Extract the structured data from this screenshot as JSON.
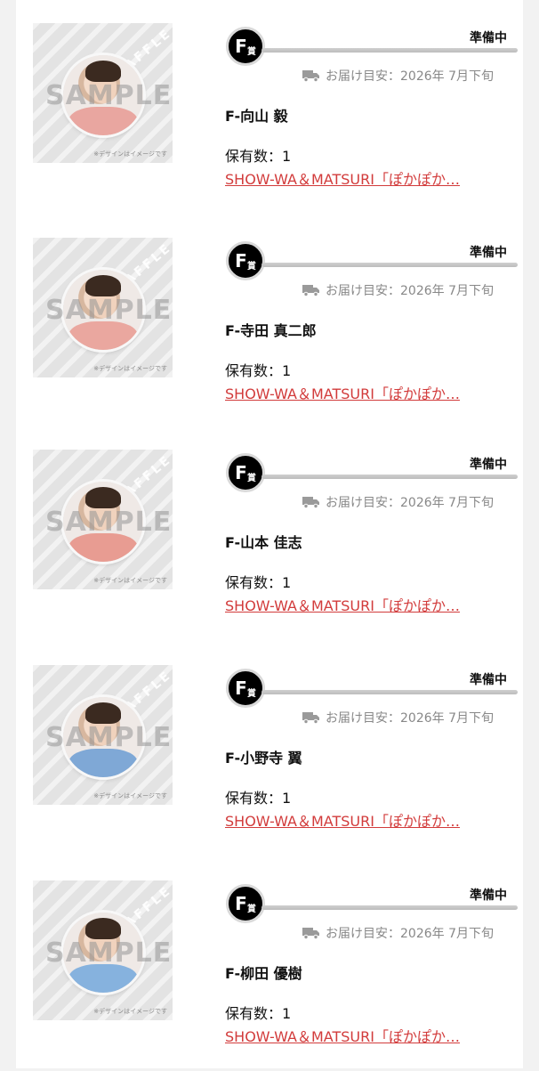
{
  "items": [
    {
      "grade_letter": "F",
      "grade_suffix": "賞",
      "status": "準備中",
      "delivery": "お届け目安：2026年 7月下旬",
      "name": "F-向山 毅",
      "quantity": "保有数：1",
      "link": "SHOW-WA＆MATSURI「ぽかぽか…",
      "thumb": {
        "sample": "SAMPLE",
        "raffle": "RAFFLE",
        "note": "※デザインはイメージです",
        "shirt_color": "#e9a6a0"
      }
    },
    {
      "grade_letter": "F",
      "grade_suffix": "賞",
      "status": "準備中",
      "delivery": "お届け目安：2026年 7月下旬",
      "name": "F-寺田 真二郎",
      "quantity": "保有数：1",
      "link": "SHOW-WA＆MATSURI「ぽかぽか…",
      "thumb": {
        "sample": "SAMPLE",
        "raffle": "RAFFLE",
        "note": "※デザインはイメージです",
        "shirt_color": "#eaa79f"
      }
    },
    {
      "grade_letter": "F",
      "grade_suffix": "賞",
      "status": "準備中",
      "delivery": "お届け目安：2026年 7月下旬",
      "name": "F-山本 佳志",
      "quantity": "保有数：1",
      "link": "SHOW-WA＆MATSURI「ぽかぽか…",
      "thumb": {
        "sample": "SAMPLE",
        "raffle": "RAFFLE",
        "note": "※デザインはイメージです",
        "shirt_color": "#e89c92"
      }
    },
    {
      "grade_letter": "F",
      "grade_suffix": "賞",
      "status": "準備中",
      "delivery": "お届け目安：2026年 7月下旬",
      "name": "F-小野寺 翼",
      "quantity": "保有数：1",
      "link": "SHOW-WA＆MATSURI「ぽかぽか…",
      "thumb": {
        "sample": "SAMPLE",
        "raffle": "RAFFLE",
        "note": "※デザインはイメージです",
        "shirt_color": "#7fa8d6"
      }
    },
    {
      "grade_letter": "F",
      "grade_suffix": "賞",
      "status": "準備中",
      "delivery": "お届け目安：2026年 7月下旬",
      "name": "F-柳田 優樹",
      "quantity": "保有数：1",
      "link": "SHOW-WA＆MATSURI「ぽかぽか…",
      "thumb": {
        "sample": "SAMPLE",
        "raffle": "RAFFLE",
        "note": "※デザインはイメージです",
        "shirt_color": "#86b2de"
      }
    }
  ]
}
